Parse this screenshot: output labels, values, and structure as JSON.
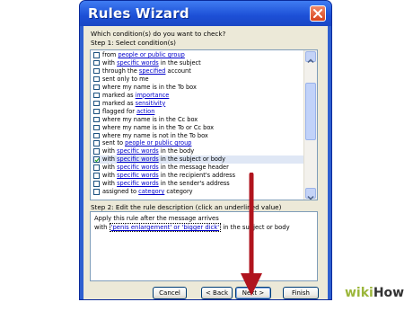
{
  "window": {
    "title": "Rules Wizard"
  },
  "prompt": "Which condition(s) do you want to check?",
  "step1_label": "Step 1: Select condition(s)",
  "conditions": [
    {
      "pre": "from ",
      "link": "people or public group",
      "post": "",
      "checked": false
    },
    {
      "pre": "with ",
      "link": "specific words",
      "post": " in the subject",
      "checked": false
    },
    {
      "pre": "through the ",
      "link": "specified",
      "post": " account",
      "checked": false
    },
    {
      "pre": "sent only to me",
      "link": "",
      "post": "",
      "checked": false
    },
    {
      "pre": "where my name is in the To box",
      "link": "",
      "post": "",
      "checked": false
    },
    {
      "pre": "marked as ",
      "link": "importance",
      "post": "",
      "checked": false
    },
    {
      "pre": "marked as ",
      "link": "sensitivity",
      "post": "",
      "checked": false
    },
    {
      "pre": "flagged for ",
      "link": "action",
      "post": "",
      "checked": false
    },
    {
      "pre": "where my name is in the Cc box",
      "link": "",
      "post": "",
      "checked": false
    },
    {
      "pre": "where my name is in the To or Cc box",
      "link": "",
      "post": "",
      "checked": false
    },
    {
      "pre": "where my name is not in the To box",
      "link": "",
      "post": "",
      "checked": false
    },
    {
      "pre": "sent to ",
      "link": "people or public group",
      "post": "",
      "checked": false
    },
    {
      "pre": "with ",
      "link": "specific words",
      "post": " in the body",
      "checked": false
    },
    {
      "pre": "with ",
      "link": "specific words",
      "post": " in the subject or body",
      "checked": true
    },
    {
      "pre": "with ",
      "link": "specific words",
      "post": " in the message header",
      "checked": false
    },
    {
      "pre": "with ",
      "link": "specific words",
      "post": " in the recipient's address",
      "checked": false
    },
    {
      "pre": "with ",
      "link": "specific words",
      "post": " in the sender's address",
      "checked": false
    },
    {
      "pre": "assigned to ",
      "link": "category",
      "post": " category",
      "checked": false
    }
  ],
  "step2_label": "Step 2: Edit the rule description (click an underlined value)",
  "description": {
    "line1": "Apply this rule after the message arrives",
    "line2_pre": "with ",
    "line2_value": "'penis enlargement' or 'bigger dick'",
    "line2_post": " in the subject or body"
  },
  "buttons": {
    "cancel": "Cancel",
    "back": "< Back",
    "next": "Next >",
    "finish": "Finish"
  },
  "watermark": {
    "part1": "wiki",
    "part2": "How"
  },
  "colors": {
    "titlebar": "#1c4fd6",
    "client": "#ece9d8",
    "link": "#0000cc",
    "arrow": "#b0141e"
  }
}
